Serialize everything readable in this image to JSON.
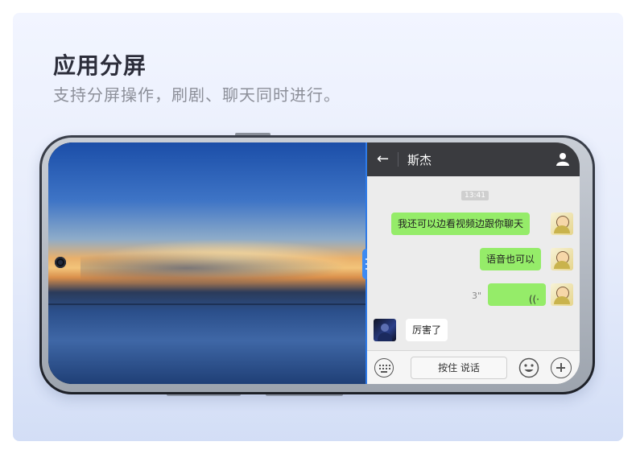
{
  "header": {
    "title": "应用分屏",
    "subtitle": "支持分屏操作，刷剧、聊天同时进行。"
  },
  "chat": {
    "contact_name": "斯杰",
    "back_icon": "arrow-left-icon",
    "profile_icon": "person-icon",
    "timestamp": "13:41",
    "messages": [
      {
        "side": "right",
        "type": "text",
        "text": "我还可以边看视频边跟你聊天"
      },
      {
        "side": "right",
        "type": "text",
        "text": "语音也可以"
      },
      {
        "side": "right",
        "type": "voice",
        "duration": "3\"",
        "glyph": "((·"
      },
      {
        "side": "left",
        "type": "text",
        "text": "厉害了"
      }
    ],
    "input": {
      "hold_to_talk": "按住 说话",
      "keyboard_icon": "keyboard-icon",
      "emoji_icon": "smiley-icon",
      "plus_icon": "plus-icon"
    }
  },
  "colors": {
    "divider": "#2f7be8",
    "bubble_green": "#95ec69",
    "topbar": "#3a3b3f"
  }
}
